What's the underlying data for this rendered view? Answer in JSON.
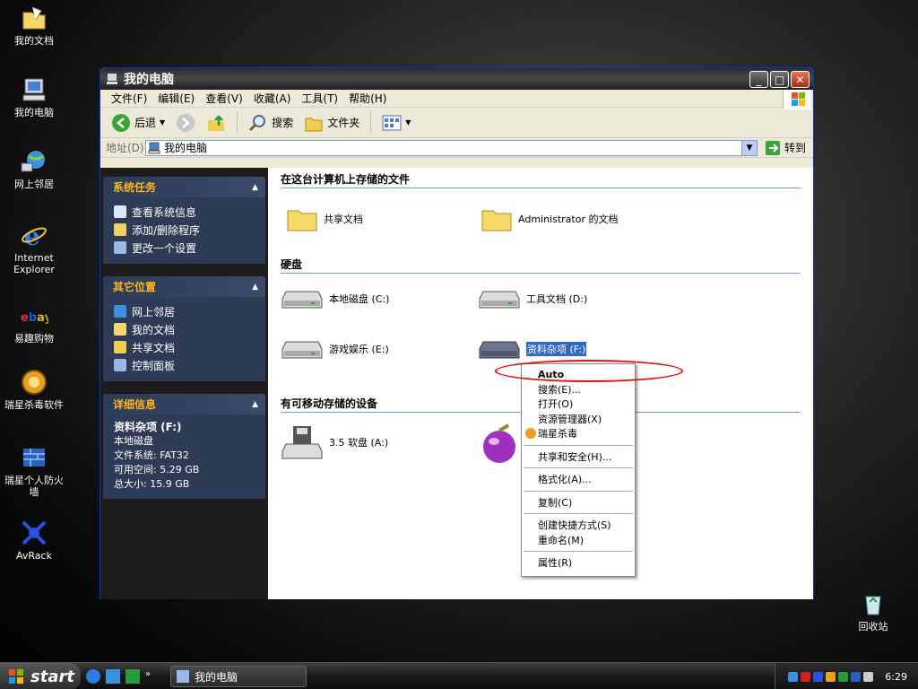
{
  "desktop": {
    "icons": [
      {
        "label": "我的文档",
        "icon": "my-documents-icon"
      },
      {
        "label": "我的电脑",
        "icon": "my-computer-icon"
      },
      {
        "label": "网上邻居",
        "icon": "network-places-icon"
      },
      {
        "label": "Internet Explorer",
        "icon": "internet-explorer-icon"
      },
      {
        "label": "易趣购物",
        "icon": "ebay-icon"
      },
      {
        "label": "瑞星杀毒软件",
        "icon": "rising-antivirus-icon"
      },
      {
        "label": "瑞星个人防火墙",
        "icon": "rising-firewall-icon"
      },
      {
        "label": "AvRack",
        "icon": "avrack-icon"
      },
      {
        "label": "回收站",
        "icon": "recycle-bin-icon"
      }
    ]
  },
  "window": {
    "title": "我的电脑",
    "menu": [
      "文件(F)",
      "编辑(E)",
      "查看(V)",
      "收藏(A)",
      "工具(T)",
      "帮助(H)"
    ],
    "toolbar": {
      "back": "后退",
      "search": "搜索",
      "folders": "文件夹"
    },
    "address": {
      "label": "地址(D)",
      "value": "我的电脑",
      "go": "转到"
    }
  },
  "sidebar": {
    "system_tasks": {
      "title": "系统任务",
      "items": [
        "查看系统信息",
        "添加/删除程序",
        "更改一个设置"
      ]
    },
    "other_places": {
      "title": "其它位置",
      "items": [
        "网上邻居",
        "我的文档",
        "共享文档",
        "控制面板"
      ]
    },
    "details": {
      "title": "详细信息",
      "name": "资料杂项 (F:)",
      "type": "本地磁盘",
      "fs": "文件系统: FAT32",
      "free": "可用空间: 5.29 GB",
      "total": "总大小: 15.9 GB"
    }
  },
  "content": {
    "group_files": "在这台计算机上存储的文件",
    "files": [
      "共享文档",
      "Administrator 的文档"
    ],
    "group_hdd": "硬盘",
    "drives": [
      "本地磁盘 (C:)",
      "工具文档 (D:)",
      "游戏娱乐 (E:)",
      "资料杂项 (F:)"
    ],
    "group_removable": "有可移动存储的设备",
    "removable": [
      "3.5 软盘 (A:)"
    ]
  },
  "context_menu": {
    "items": [
      "Auto",
      "搜索(E)...",
      "打开(O)",
      "资源管理器(X)",
      "瑞星杀毒",
      "共享和安全(H)...",
      "格式化(A)...",
      "复制(C)",
      "创建快捷方式(S)",
      "重命名(M)",
      "属性(R)"
    ]
  },
  "taskbar": {
    "start": "start",
    "task": "我的电脑",
    "clock": "6:29"
  },
  "colors": {
    "sidebar_heading": "#ffb41e",
    "annotation": "#e01010",
    "link_blue": "#0831d9"
  }
}
